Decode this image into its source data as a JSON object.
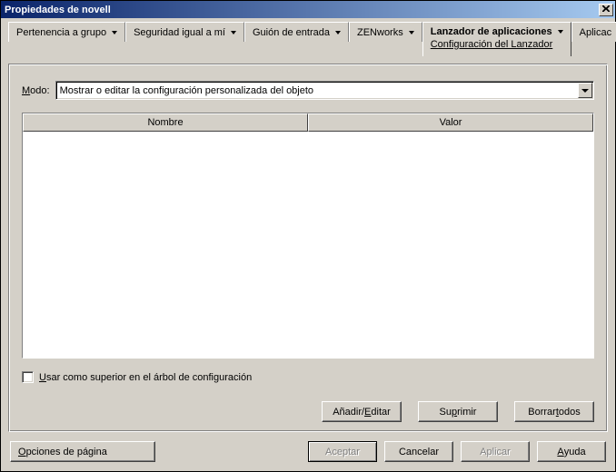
{
  "window": {
    "title": "Propiedades de novell"
  },
  "tabs": {
    "pertenencia": "Pertenencia a grupo",
    "seguridad": "Seguridad igual a mí",
    "guion": "Guión de entrada",
    "zenworks": "ZENworks",
    "lanzador": "Lanzador de aplicaciones",
    "lanzador_sub": "Configuración del Lanzador",
    "aplicac_partial": "Aplicac"
  },
  "mode": {
    "label_pre": "M",
    "label_post": "odo:",
    "value": "Mostrar o editar la configuración personalizada del objeto"
  },
  "table": {
    "columns": {
      "nombre": "Nombre",
      "valor": "Valor"
    },
    "rows": []
  },
  "checkbox": {
    "checked": false,
    "label_pre": "U",
    "label_post": "sar como superior en el árbol de configuración"
  },
  "panel_buttons": {
    "anadir_pre": "Añadir/",
    "anadir_u": "E",
    "anadir_post": "ditar",
    "suprimir_pre": "Su",
    "suprimir_u": "p",
    "suprimir_post": "rimir",
    "borrar_pre": "Borrar ",
    "borrar_u": "t",
    "borrar_post": "odos"
  },
  "footer": {
    "page_options_pre": "",
    "page_options_u": "O",
    "page_options_post": "pciones de página",
    "aceptar": "Aceptar",
    "cancelar": "Cancelar",
    "aplicar": "Aplicar",
    "ayuda_u": "A",
    "ayuda_post": "yuda"
  }
}
